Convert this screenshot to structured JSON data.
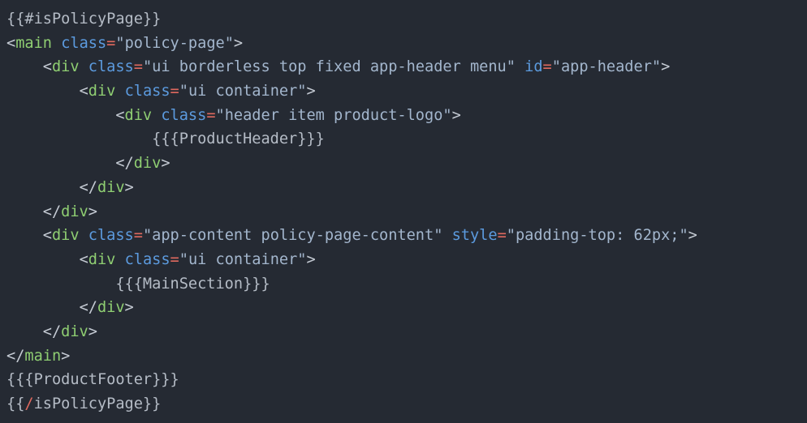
{
  "editor": {
    "background_color": "#252a33",
    "language": "handlebars-html",
    "font_size_px": 18.6,
    "line_height_px": 29.7
  },
  "palette": {
    "punctuation": "#c5cbd4",
    "tag_name": "#8fce72",
    "attribute_name": "#5c9bdf",
    "equals": "#e0695f",
    "string_value": "#a3b6cd",
    "mustache": "#b5bcc6",
    "mustache_slash": "#e0695f"
  },
  "code": {
    "lines": [
      {
        "id": "line-1",
        "indent": "",
        "tokens": [
          {
            "type": "mustache",
            "text": "{{#isPolicyPage}}"
          }
        ],
        "plain": "{{#isPolicyPage}}"
      },
      {
        "id": "line-2",
        "indent": "",
        "tokens": [
          {
            "type": "punct",
            "text": "<"
          },
          {
            "type": "tag",
            "text": "main"
          },
          {
            "type": "plain",
            "text": " "
          },
          {
            "type": "attr",
            "text": "class"
          },
          {
            "type": "eq",
            "text": "="
          },
          {
            "type": "str",
            "text": "\"policy-page\""
          },
          {
            "type": "punct",
            "text": ">"
          }
        ],
        "plain": "<main class=\"policy-page\">"
      },
      {
        "id": "line-3",
        "indent": "    ",
        "tokens": [
          {
            "type": "punct",
            "text": "<"
          },
          {
            "type": "tag",
            "text": "div"
          },
          {
            "type": "plain",
            "text": " "
          },
          {
            "type": "attr",
            "text": "class"
          },
          {
            "type": "eq",
            "text": "="
          },
          {
            "type": "str",
            "text": "\"ui borderless top fixed app-header menu\""
          },
          {
            "type": "plain",
            "text": " "
          },
          {
            "type": "attr",
            "text": "id"
          },
          {
            "type": "eq",
            "text": "="
          },
          {
            "type": "str",
            "text": "\"app-header\""
          },
          {
            "type": "punct",
            "text": ">"
          }
        ],
        "plain": "    <div class=\"ui borderless top fixed app-header menu\" id=\"app-header\">"
      },
      {
        "id": "line-4",
        "indent": "        ",
        "tokens": [
          {
            "type": "punct",
            "text": "<"
          },
          {
            "type": "tag",
            "text": "div"
          },
          {
            "type": "plain",
            "text": " "
          },
          {
            "type": "attr",
            "text": "class"
          },
          {
            "type": "eq",
            "text": "="
          },
          {
            "type": "str",
            "text": "\"ui container\""
          },
          {
            "type": "punct",
            "text": ">"
          }
        ],
        "plain": "        <div class=\"ui container\">"
      },
      {
        "id": "line-5",
        "indent": "            ",
        "tokens": [
          {
            "type": "punct",
            "text": "<"
          },
          {
            "type": "tag",
            "text": "div"
          },
          {
            "type": "plain",
            "text": " "
          },
          {
            "type": "attr",
            "text": "class"
          },
          {
            "type": "eq",
            "text": "="
          },
          {
            "type": "str",
            "text": "\"header item product-logo\""
          },
          {
            "type": "punct",
            "text": ">"
          }
        ],
        "plain": "            <div class=\"header item product-logo\">"
      },
      {
        "id": "line-6",
        "indent": "                ",
        "tokens": [
          {
            "type": "mustache",
            "text": "{{{ProductHeader}}}"
          }
        ],
        "plain": "                {{{ProductHeader}}}"
      },
      {
        "id": "line-7",
        "indent": "            ",
        "tokens": [
          {
            "type": "punct",
            "text": "</"
          },
          {
            "type": "tag",
            "text": "div"
          },
          {
            "type": "punct",
            "text": ">"
          }
        ],
        "plain": "            </div>"
      },
      {
        "id": "line-8",
        "indent": "        ",
        "tokens": [
          {
            "type": "punct",
            "text": "</"
          },
          {
            "type": "tag",
            "text": "div"
          },
          {
            "type": "punct",
            "text": ">"
          }
        ],
        "plain": "        </div>"
      },
      {
        "id": "line-9",
        "indent": "    ",
        "tokens": [
          {
            "type": "punct",
            "text": "</"
          },
          {
            "type": "tag",
            "text": "div"
          },
          {
            "type": "punct",
            "text": ">"
          }
        ],
        "plain": "    </div>"
      },
      {
        "id": "line-10",
        "indent": "    ",
        "tokens": [
          {
            "type": "punct",
            "text": "<"
          },
          {
            "type": "tag",
            "text": "div"
          },
          {
            "type": "plain",
            "text": " "
          },
          {
            "type": "attr",
            "text": "class"
          },
          {
            "type": "eq",
            "text": "="
          },
          {
            "type": "str",
            "text": "\"app-content policy-page-content\""
          },
          {
            "type": "plain",
            "text": " "
          },
          {
            "type": "attr",
            "text": "style"
          },
          {
            "type": "eq",
            "text": "="
          },
          {
            "type": "str",
            "text": "\"padding-top: 62px;\""
          },
          {
            "type": "punct",
            "text": ">"
          }
        ],
        "plain": "    <div class=\"app-content policy-page-content\" style=\"padding-top: 62px;\">"
      },
      {
        "id": "line-11",
        "indent": "        ",
        "tokens": [
          {
            "type": "punct",
            "text": "<"
          },
          {
            "type": "tag",
            "text": "div"
          },
          {
            "type": "plain",
            "text": " "
          },
          {
            "type": "attr",
            "text": "class"
          },
          {
            "type": "eq",
            "text": "="
          },
          {
            "type": "str",
            "text": "\"ui container\""
          },
          {
            "type": "punct",
            "text": ">"
          }
        ],
        "plain": "        <div class=\"ui container\">"
      },
      {
        "id": "line-12",
        "indent": "            ",
        "tokens": [
          {
            "type": "mustache",
            "text": "{{{MainSection}}}"
          }
        ],
        "plain": "            {{{MainSection}}}"
      },
      {
        "id": "line-13",
        "indent": "        ",
        "tokens": [
          {
            "type": "punct",
            "text": "</"
          },
          {
            "type": "tag",
            "text": "div"
          },
          {
            "type": "punct",
            "text": ">"
          }
        ],
        "plain": "        </div>"
      },
      {
        "id": "line-14",
        "indent": "    ",
        "tokens": [
          {
            "type": "punct",
            "text": "</"
          },
          {
            "type": "tag",
            "text": "div"
          },
          {
            "type": "punct",
            "text": ">"
          }
        ],
        "plain": "    </div>"
      },
      {
        "id": "line-15",
        "indent": "",
        "tokens": [
          {
            "type": "punct",
            "text": "</"
          },
          {
            "type": "tag",
            "text": "main"
          },
          {
            "type": "punct",
            "text": ">"
          }
        ],
        "plain": "</main>"
      },
      {
        "id": "line-16",
        "indent": "",
        "tokens": [
          {
            "type": "mustache",
            "text": "{{{ProductFooter}}}"
          }
        ],
        "plain": "{{{ProductFooter}}}"
      },
      {
        "id": "line-17",
        "indent": "",
        "tokens": [
          {
            "type": "mustache",
            "text": "{{"
          },
          {
            "type": "mslash",
            "text": "/"
          },
          {
            "type": "mustache",
            "text": "isPolicyPage}}"
          }
        ],
        "plain": "{{/isPolicyPage}}"
      }
    ]
  }
}
